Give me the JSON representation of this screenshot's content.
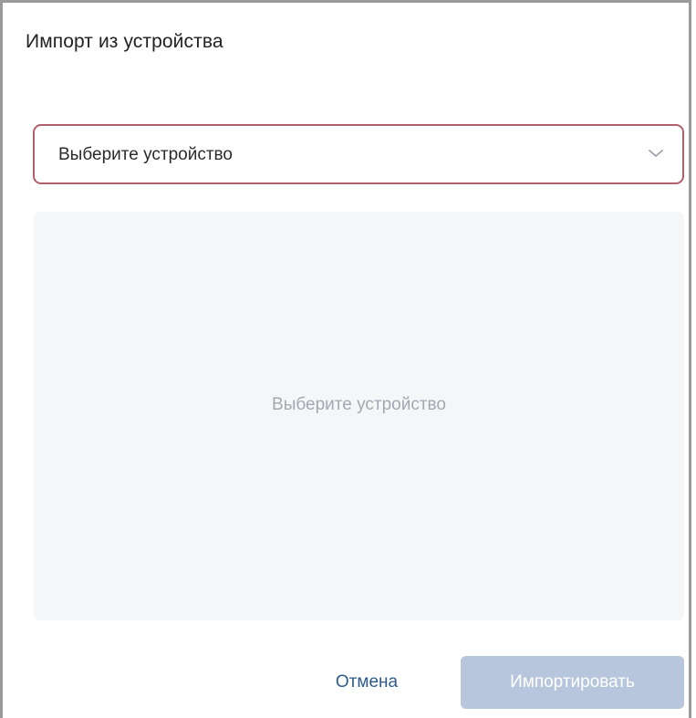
{
  "dialog": {
    "title": "Импорт из устройства"
  },
  "device_select": {
    "value": "Выберите устройство",
    "icon": "chevron-down-icon",
    "border_color": "#b0606a"
  },
  "preview": {
    "placeholder": "Выберите устройство"
  },
  "footer": {
    "cancel_label": "Отмена",
    "import_label": "Импортировать",
    "import_enabled": false
  },
  "colors": {
    "link": "#2e5b8a",
    "disabled_button": "#b7c6dc",
    "panel_bg": "#f5f6f8"
  }
}
